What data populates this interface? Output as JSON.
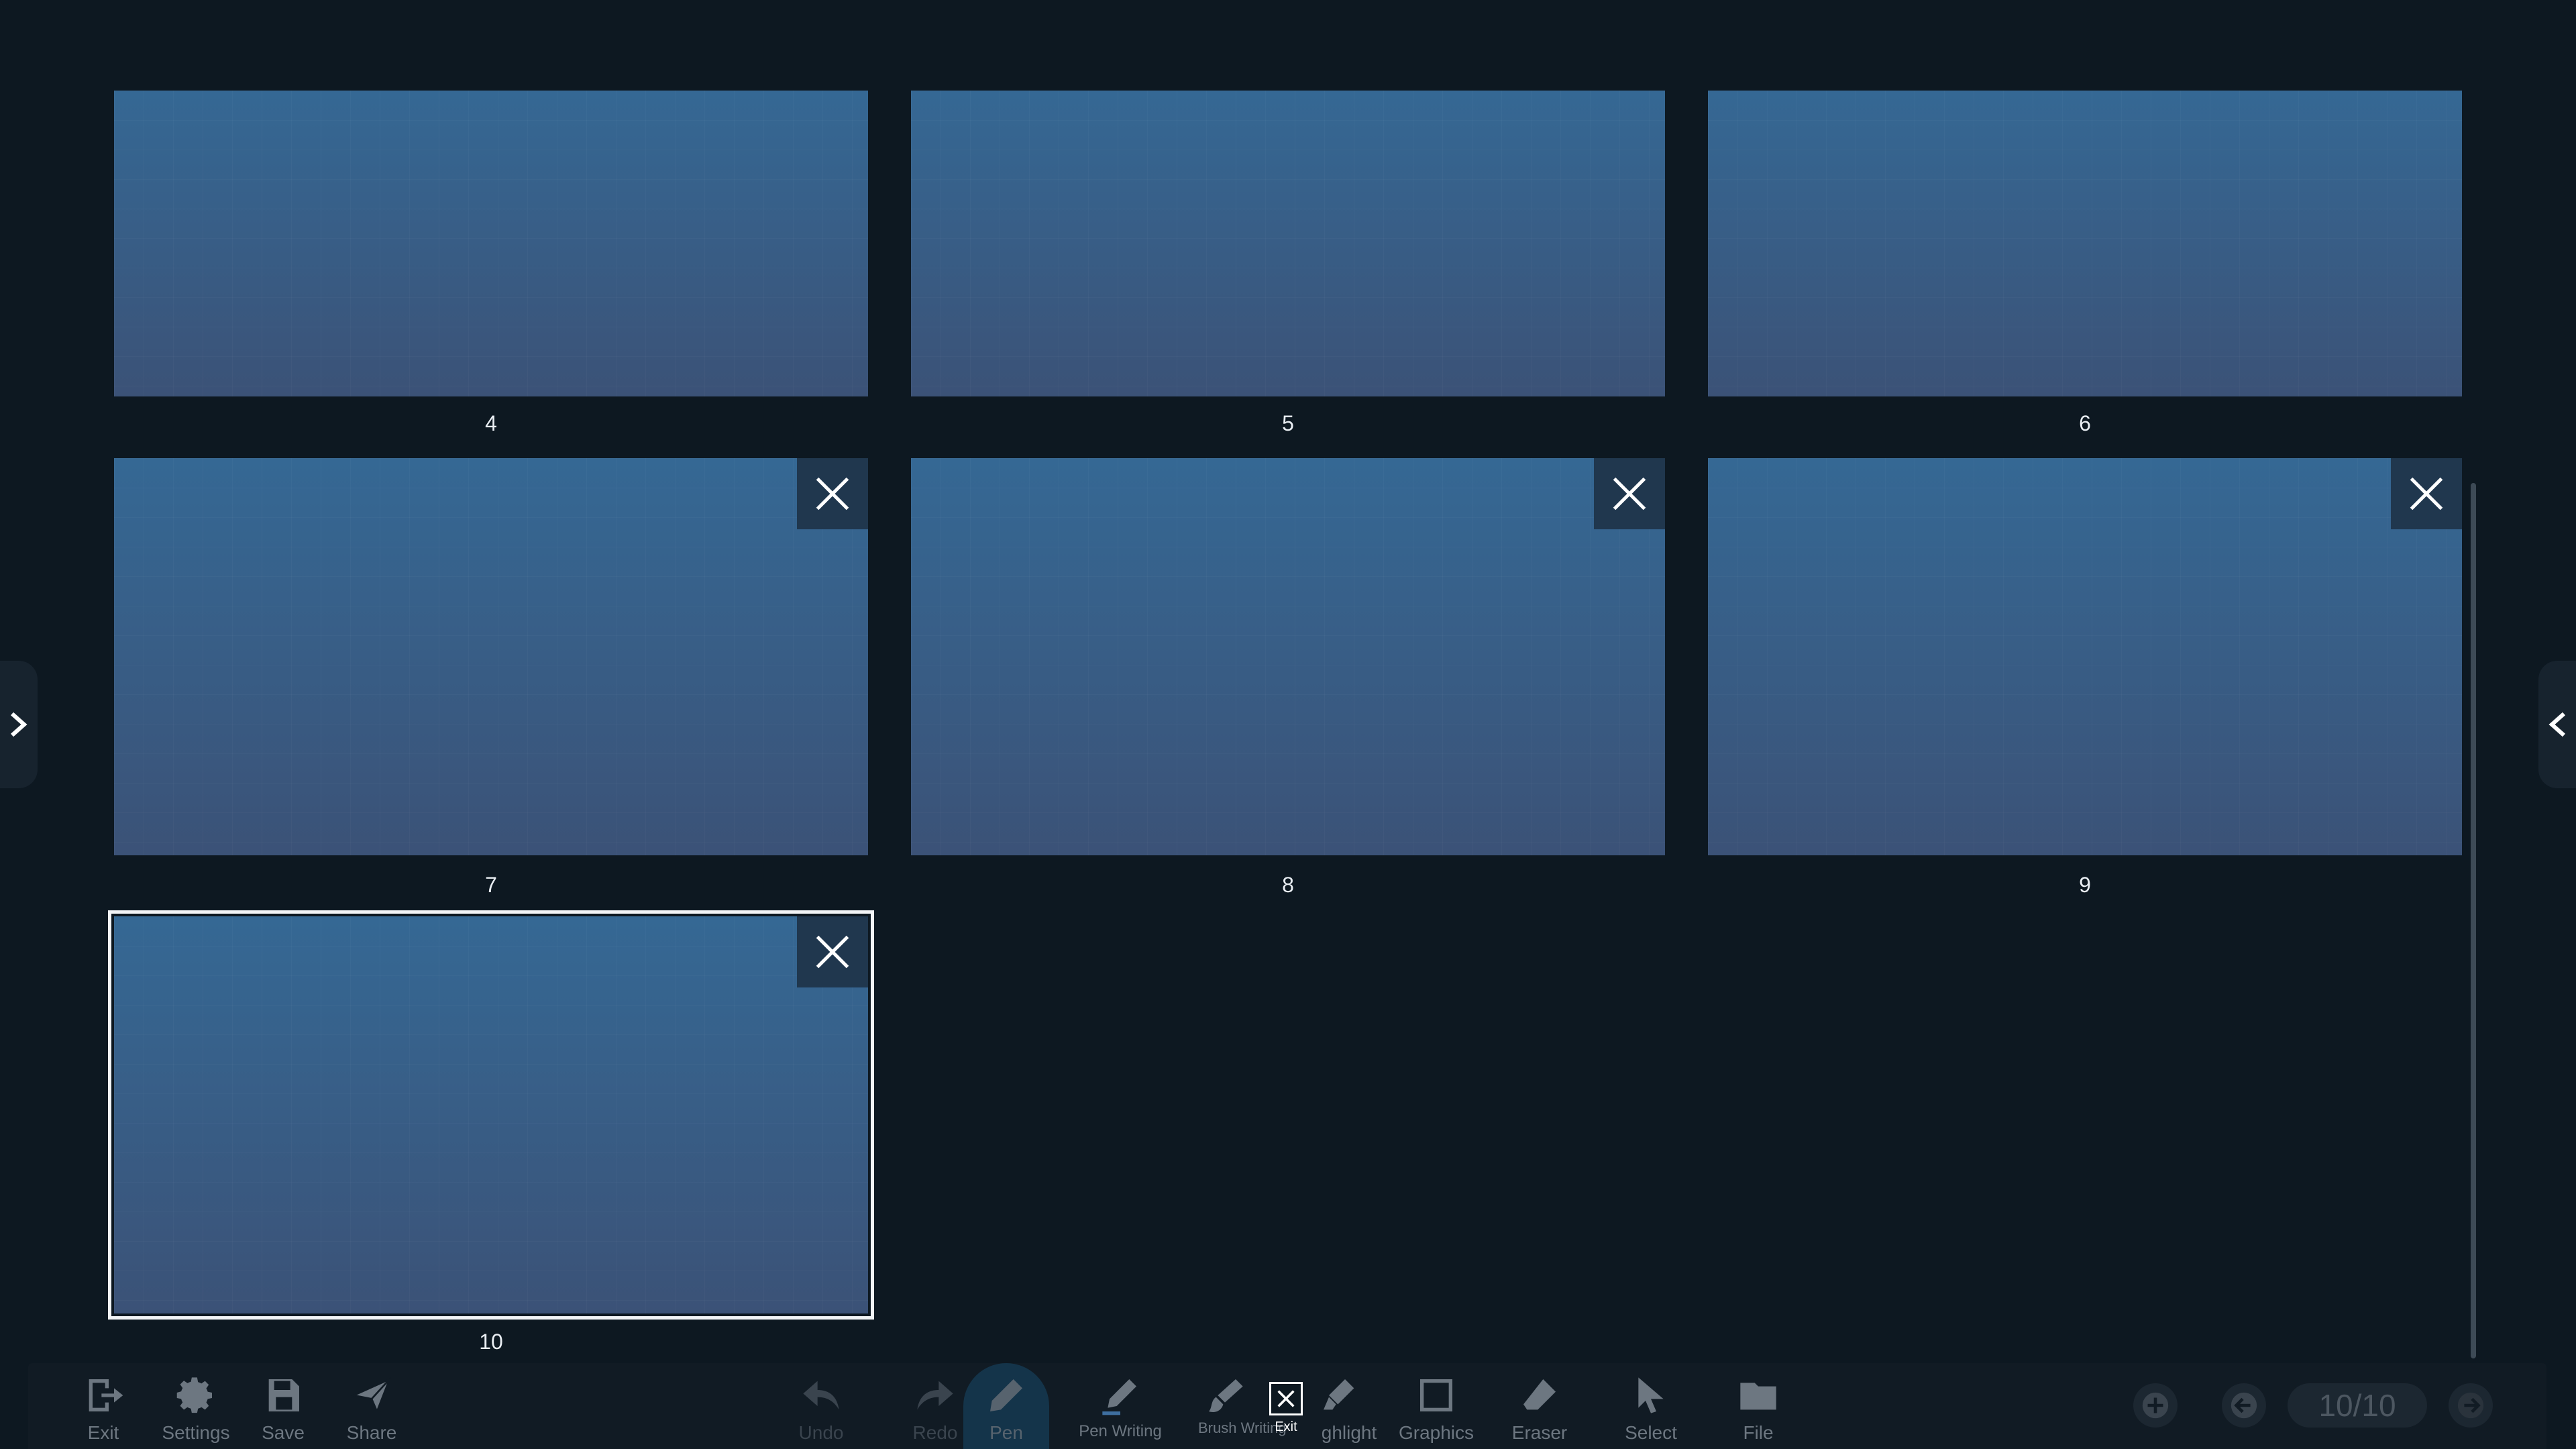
{
  "pages": [
    {
      "number": "4",
      "closable": false,
      "selected": false
    },
    {
      "number": "5",
      "closable": false,
      "selected": false
    },
    {
      "number": "6",
      "closable": false,
      "selected": false
    },
    {
      "number": "7",
      "closable": true,
      "selected": false
    },
    {
      "number": "8",
      "closable": true,
      "selected": false
    },
    {
      "number": "9",
      "closable": true,
      "selected": false
    },
    {
      "number": "10",
      "closable": true,
      "selected": true
    }
  ],
  "toolbar": {
    "exit_label": "Exit",
    "settings_label": "Settings",
    "save_label": "Save",
    "share_label": "Share",
    "undo_label": "Undo",
    "redo_label": "Redo",
    "pen_label": "Pen",
    "pen_writing_label": "Pen Writing",
    "brush_writing_label": "Brush Writing",
    "highlight_label_visible": "ghlight",
    "graphics_label": "Graphics",
    "eraser_label": "Eraser",
    "select_label": "Select",
    "file_label": "File",
    "exit_tooltip": "Exit",
    "page_indicator": "10/10"
  },
  "colors": {
    "background": "#0d1821",
    "thumbnail_top": "#356894",
    "thumbnail_bottom": "#3b5277",
    "close_button_bg": "#20374e",
    "selected_border": "#f2f4f6"
  }
}
